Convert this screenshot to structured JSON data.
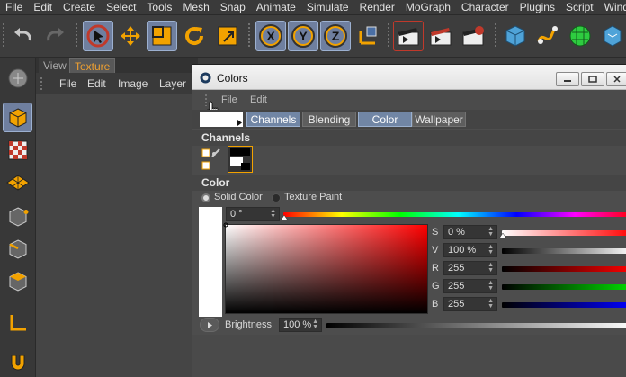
{
  "menubar": [
    "File",
    "Edit",
    "Create",
    "Select",
    "Tools",
    "Mesh",
    "Snap",
    "Animate",
    "Simulate",
    "Render",
    "MoGraph",
    "Character",
    "Plugins",
    "Script",
    "Wind"
  ],
  "left_tabs": {
    "view": "View",
    "texture": "Texture"
  },
  "texture_menu": [
    "File",
    "Edit",
    "Image",
    "Layer"
  ],
  "toolbar": {
    "axis_x": "X",
    "axis_y": "Y",
    "axis_z": "Z"
  },
  "dialog": {
    "title": "Colors",
    "menu": [
      "File",
      "Edit"
    ],
    "tabs": [
      "Channels",
      "Blending",
      "Color",
      "Wallpaper"
    ],
    "active_tab": "Color",
    "channels_header": "Channels",
    "color_header": "Color",
    "mode_solid": "Solid Color",
    "mode_texture": "Texture Paint",
    "hue_value": "0 °",
    "s_label": "S",
    "s_value": "0 %",
    "v_label": "V",
    "v_value": "100 %",
    "r_label": "R",
    "r_value": "255",
    "g_label": "G",
    "g_value": "255",
    "b_label": "B",
    "b_value": "255",
    "brightness_label": "Brightness",
    "brightness_value": "100 %"
  },
  "colors": {
    "accent_blue": "#7186a5",
    "texture_tab_orange": "#f0a030",
    "swatch_white": "#ffffff",
    "hue_red": "#ff0000"
  }
}
